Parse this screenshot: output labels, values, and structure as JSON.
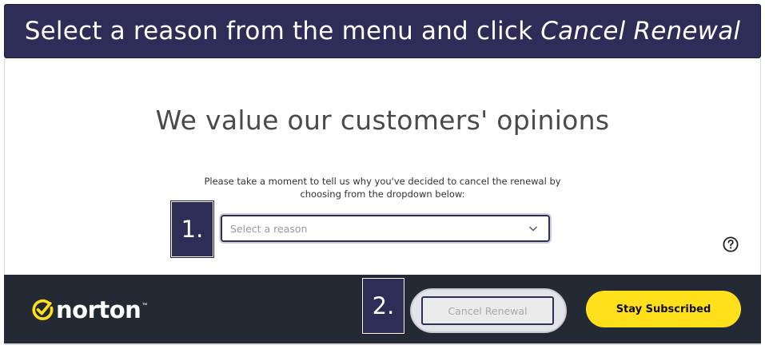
{
  "banner": {
    "prefix": "Select a reason from the menu and click ",
    "emphasis": "Cancel Renewal"
  },
  "page": {
    "heading": "We value our customers' opinions",
    "description_line1": "Please take a moment to tell us why you've decided to cancel the renewal by",
    "description_line2": "choosing from the dropdown below:"
  },
  "dropdown": {
    "placeholder": "Select a reason",
    "icon": "chevron-down-icon"
  },
  "help": {
    "icon": "question-circle-icon"
  },
  "steps": {
    "step1": "1.",
    "step2": "2."
  },
  "footer": {
    "brand": "norton",
    "trademark": "™",
    "cancel_label": "Cancel Renewal",
    "stay_label": "Stay Subscribed"
  },
  "colors": {
    "banner_bg": "#2e2d58",
    "footer_bg": "#242a33",
    "accent_yellow": "#ffe01b",
    "heading_text": "#4a4a4a"
  }
}
